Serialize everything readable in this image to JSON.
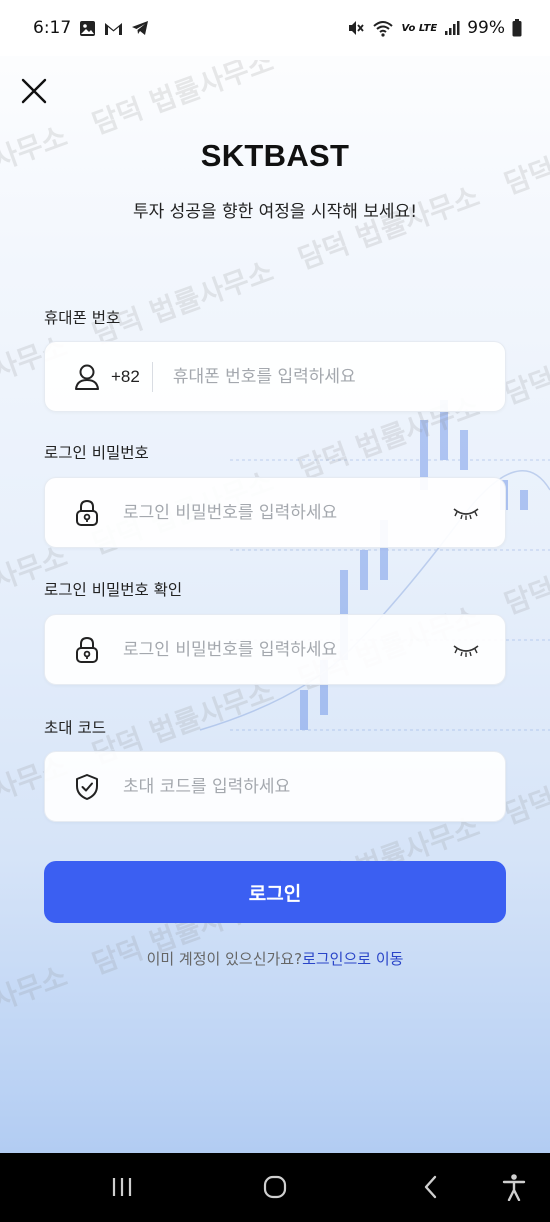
{
  "status_bar": {
    "time": "6:17",
    "network_label": "Vo LTE",
    "battery": "99%"
  },
  "icons": {
    "close": "close-icon",
    "user": "user-icon",
    "lock": "lock-icon",
    "eye_closed": "eye-closed-icon",
    "shield": "shield-check-icon"
  },
  "header": {
    "title": "SKTBAST",
    "subtitle": "투자 성공을 향한 여정을 시작해 보세요!"
  },
  "form": {
    "phone": {
      "label": "휴대폰 번호",
      "country_code": "+82",
      "placeholder": "휴대폰 번호를 입력하세요",
      "value": ""
    },
    "password": {
      "label": "로그인 비밀번호",
      "placeholder": "로그인 비밀번호를 입력하세요",
      "value": ""
    },
    "password_confirm": {
      "label": "로그인 비밀번호 확인",
      "placeholder": "로그인 비밀번호를 입력하세요",
      "value": ""
    },
    "invite_code": {
      "label": "초대 코드",
      "placeholder": "초대 코드를 입력하세요",
      "value": ""
    },
    "submit_label": "로그인"
  },
  "footer": {
    "question": "이미 계정이 있으신가요?",
    "link": "로그인으로 이동"
  },
  "watermark_text": "담덕 법률사무소",
  "colors": {
    "accent": "#3b5ff2",
    "link": "#2a45c8",
    "nav_bar": "#000000"
  }
}
